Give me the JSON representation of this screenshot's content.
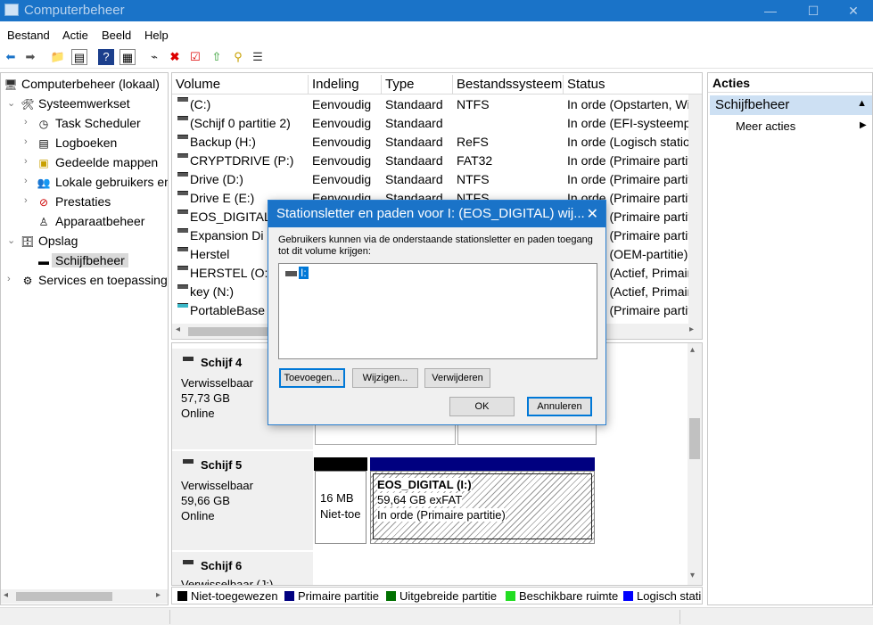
{
  "window": {
    "title": "Computerbeheer",
    "controls": [
      "—",
      "☐",
      "✕"
    ]
  },
  "menu": [
    "Bestand",
    "Actie",
    "Beeld",
    "Help"
  ],
  "toolbar_icons": [
    "back-icon",
    "forward-icon",
    "up-folder-icon",
    "show-hide-tree-icon",
    "help-icon",
    "properties-icon",
    "connect-icon",
    "delete-icon",
    "check-icon",
    "folder-up-icon",
    "search-icon",
    "list-icon"
  ],
  "tree": {
    "root": "Computerbeheer (lokaal)",
    "items": [
      {
        "label": "Systeemwerkset",
        "icon": "tools-icon"
      },
      {
        "label": "Task Scheduler",
        "icon": "clock-icon"
      },
      {
        "label": "Logboeken",
        "icon": "log-icon"
      },
      {
        "label": "Gedeelde mappen",
        "icon": "shared-folder-icon"
      },
      {
        "label": "Lokale gebruikers en groepen",
        "icon": "users-icon"
      },
      {
        "label": "Prestaties",
        "icon": "performance-icon"
      },
      {
        "label": "Apparaatbeheer",
        "icon": "device-manager-icon"
      },
      {
        "label": "Opslag",
        "icon": "storage-icon"
      },
      {
        "label": "Schijfbeheer",
        "icon": "disk-management-icon"
      },
      {
        "label": "Services en toepassingen",
        "icon": "services-icon"
      }
    ]
  },
  "volumes": {
    "headers": [
      "Volume",
      "Indeling",
      "Type",
      "Bestandssysteem",
      "Status"
    ],
    "rows": [
      [
        "(C:)",
        "Eenvoudig",
        "Standaard",
        "NTFS",
        "In orde (Opstarten, Wis"
      ],
      [
        "(Schijf 0 partitie 2)",
        "Eenvoudig",
        "Standaard",
        "",
        "In orde (EFI-systeempa"
      ],
      [
        "Backup (H:)",
        "Eenvoudig",
        "Standaard",
        "ReFS",
        "In orde (Logisch station"
      ],
      [
        "CRYPTDRIVE (P:)",
        "Eenvoudig",
        "Standaard",
        "FAT32",
        "In orde (Primaire partit"
      ],
      [
        "Drive (D:)",
        "Eenvoudig",
        "Standaard",
        "NTFS",
        "In orde (Primaire partit"
      ],
      [
        "Drive E (E:)",
        "Eenvoudig",
        "Standaard",
        "NTFS",
        "In orde (Primaire partit"
      ],
      [
        "EOS_DIGITAL",
        "",
        "",
        "",
        "In orde (Primaire partit"
      ],
      [
        "Expansion Di",
        "",
        "",
        "",
        "In orde (Primaire partit"
      ],
      [
        "Herstel",
        "",
        "",
        "",
        "In orde (OEM-partitie)"
      ],
      [
        "HERSTEL (O:)",
        "",
        "",
        "",
        "In orde (Actief, Primaire"
      ],
      [
        "key (N:)",
        "",
        "",
        "",
        "In orde (Actief, Primaire"
      ],
      [
        "PortableBase",
        "",
        "",
        "",
        "In orde (Primaire partit"
      ]
    ]
  },
  "disks": [
    {
      "name": "Schijf 4",
      "type": "Verwisselbaar",
      "size": "57,73 GB",
      "state": "Online"
    },
    {
      "name": "Schijf 5",
      "type": "Verwisselbaar",
      "size": "59,66 GB",
      "state": "Online",
      "partitions": [
        {
          "line1": "16 MB",
          "line2": "Niet-toe"
        },
        {
          "name": "EOS_DIGITAL  (I:)",
          "line1": "59,64 GB exFAT",
          "line2": "In orde (Primaire partitie)"
        }
      ]
    },
    {
      "name": "Schijf 6",
      "type": "Verwisselbaar (J:)"
    }
  ],
  "legend": [
    {
      "label": "Niet-toegewezen",
      "color": "#000000"
    },
    {
      "label": "Primaire partitie",
      "color": "#000080"
    },
    {
      "label": "Uitgebreide partitie",
      "color": "#007000"
    },
    {
      "label": "Beschikbare ruimte",
      "color": "#22dd22"
    },
    {
      "label": "Logisch stati",
      "color": "#0000ff"
    }
  ],
  "actions": {
    "header": "Acties",
    "section": "Schijfbeheer",
    "more": "Meer acties"
  },
  "dialog": {
    "title": "Stationsletter en paden voor I: (EOS_DIGITAL) wij...",
    "text": "Gebruikers kunnen via de onderstaande stationsletter en paden toegang tot dit volume krijgen:",
    "item": "I:",
    "buttons": {
      "add": "Toevoegen...",
      "change": "Wijzigen...",
      "remove": "Verwijderen",
      "ok": "OK",
      "cancel": "Annuleren"
    }
  }
}
